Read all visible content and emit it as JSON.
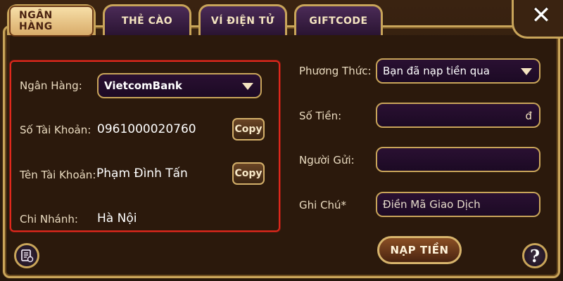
{
  "tabs": [
    {
      "label": "NGÂN HÀNG",
      "active": true
    },
    {
      "label": "THẺ CÀO",
      "active": false
    },
    {
      "label": "VÍ ĐIỆN TỬ",
      "active": false
    },
    {
      "label": "GIFTCODE",
      "active": false
    }
  ],
  "close_label": "✕",
  "bank": {
    "bank_label": "Ngân Hàng:",
    "bank_selected": "VietcomBank",
    "account_number_label": "Số Tài Khoản:",
    "account_number": "0961000020760",
    "account_name_label": "Tên Tài Khoản:",
    "account_name": "Phạm Đình Tấn",
    "branch_label": "Chi Nhánh:",
    "branch": "Hà Nội",
    "copy_label": "Copy"
  },
  "form": {
    "method_label": "Phương Thức:",
    "method_selected": "Bạn đã nạp tiền qua",
    "amount_label": "Số Tiền:",
    "amount_value": "",
    "amount_suffix": "đ",
    "sender_label": "Người Gửi:",
    "sender_value": "",
    "note_label": "Ghi Chú*",
    "note_placeholder": "Điền Mã Giao Dịch",
    "submit_label": "NẠP TIỀN"
  },
  "help_label": "?",
  "icons": {
    "history": "history-icon",
    "help": "help-icon",
    "close": "close-icon"
  },
  "colors": {
    "gold_border": "#c9a55a",
    "highlight_border": "#e0281c",
    "field_bg": "#1c0a24"
  }
}
